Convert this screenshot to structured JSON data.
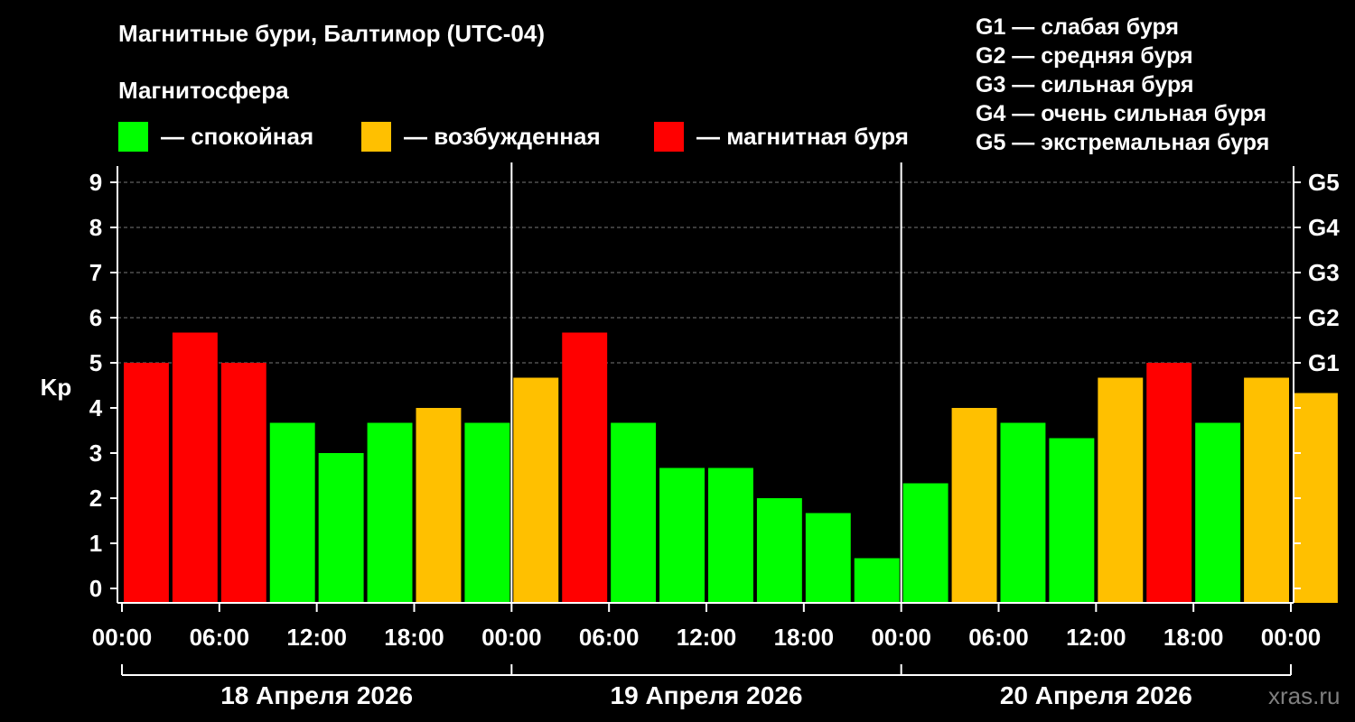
{
  "title": "Магнитные бури, Балтимор (UTC-04)",
  "magnetosphere_label": "Магнитосфера",
  "legend": [
    {
      "label": "— спокойная",
      "color": "#00ff00"
    },
    {
      "label": "— возбужденная",
      "color": "#ffc000"
    },
    {
      "label": "— магнитная буря",
      "color": "#ff0000"
    }
  ],
  "g_scale": [
    "G1 — слабая буря",
    "G2 — средняя буря",
    "G3 — сильная буря",
    "G4 — очень сильная буря",
    "G5 — экстремальная буря"
  ],
  "watermark": "xras.ru",
  "chart_data": {
    "type": "bar",
    "ylabel": "Kp",
    "ylim": [
      0,
      9
    ],
    "yticks": [
      "0",
      "1",
      "2",
      "3",
      "4",
      "5",
      "6",
      "7",
      "8",
      "9"
    ],
    "right_ticks": [
      {
        "kp": 5,
        "label": "G1"
      },
      {
        "kp": 6,
        "label": "G2"
      },
      {
        "kp": 7,
        "label": "G3"
      },
      {
        "kp": 8,
        "label": "G4"
      },
      {
        "kp": 9,
        "label": "G5"
      }
    ],
    "xtick_labels": [
      "00:00",
      "06:00",
      "12:00",
      "18:00",
      "00:00",
      "06:00",
      "12:00",
      "18:00",
      "00:00",
      "06:00",
      "12:00",
      "18:00",
      "00:00"
    ],
    "days": [
      "18 Апреля 2026",
      "19 Апреля 2026",
      "20 Апреля 2026"
    ],
    "grid": "horizontal dashed at Kp 5-9",
    "colors": {
      "quiet": "#00ff00",
      "active": "#ffc000",
      "storm": "#ff0000"
    },
    "bars": [
      {
        "start_hour": 0,
        "end_hour": 3,
        "kp": 5.0,
        "level": "storm"
      },
      {
        "start_hour": 3,
        "end_hour": 6,
        "kp": 5.67,
        "level": "storm"
      },
      {
        "start_hour": 6,
        "end_hour": 9,
        "kp": 5.0,
        "level": "storm"
      },
      {
        "start_hour": 9,
        "end_hour": 12,
        "kp": 3.67,
        "level": "quiet"
      },
      {
        "start_hour": 12,
        "end_hour": 15,
        "kp": 3.0,
        "level": "quiet"
      },
      {
        "start_hour": 15,
        "end_hour": 18,
        "kp": 3.67,
        "level": "quiet"
      },
      {
        "start_hour": 18,
        "end_hour": 21,
        "kp": 4.0,
        "level": "active"
      },
      {
        "start_hour": 21,
        "end_hour": 24,
        "kp": 3.67,
        "level": "quiet"
      },
      {
        "start_hour": 24,
        "end_hour": 27,
        "kp": 4.67,
        "level": "active"
      },
      {
        "start_hour": 27,
        "end_hour": 30,
        "kp": 5.67,
        "level": "storm"
      },
      {
        "start_hour": 30,
        "end_hour": 33,
        "kp": 3.67,
        "level": "quiet"
      },
      {
        "start_hour": 33,
        "end_hour": 36,
        "kp": 2.67,
        "level": "quiet"
      },
      {
        "start_hour": 36,
        "end_hour": 39,
        "kp": 2.67,
        "level": "quiet"
      },
      {
        "start_hour": 39,
        "end_hour": 42,
        "kp": 2.0,
        "level": "quiet"
      },
      {
        "start_hour": 42,
        "end_hour": 45,
        "kp": 1.67,
        "level": "quiet"
      },
      {
        "start_hour": 45,
        "end_hour": 48,
        "kp": 0.67,
        "level": "quiet"
      },
      {
        "start_hour": 48,
        "end_hour": 51,
        "kp": 2.33,
        "level": "quiet"
      },
      {
        "start_hour": 51,
        "end_hour": 54,
        "kp": 4.0,
        "level": "active"
      },
      {
        "start_hour": 54,
        "end_hour": 57,
        "kp": 3.67,
        "level": "quiet"
      },
      {
        "start_hour": 57,
        "end_hour": 60,
        "kp": 3.33,
        "level": "quiet"
      },
      {
        "start_hour": 60,
        "end_hour": 63,
        "kp": 4.67,
        "level": "active"
      },
      {
        "start_hour": 63,
        "end_hour": 66,
        "kp": 5.0,
        "level": "storm"
      },
      {
        "start_hour": 66,
        "end_hour": 69,
        "kp": 3.67,
        "level": "quiet"
      },
      {
        "start_hour": 69,
        "end_hour": 72,
        "kp": 4.67,
        "level": "active"
      },
      {
        "start_hour": 72,
        "end_hour": 75,
        "kp": 4.33,
        "level": "active"
      }
    ]
  }
}
